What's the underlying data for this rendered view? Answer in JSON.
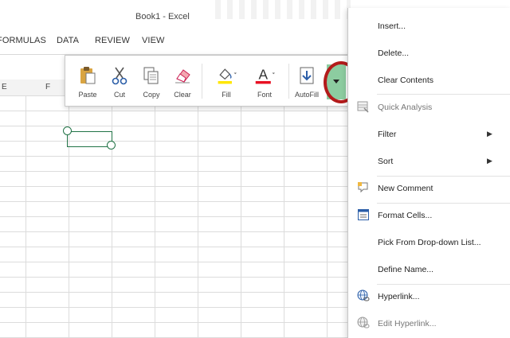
{
  "window": {
    "title": "Book1 - Excel"
  },
  "ribbon_tabs": [
    "FORMULAS",
    "DATA",
    "REVIEW",
    "VIEW"
  ],
  "column_headers": [
    "E",
    "F"
  ],
  "mini_toolbar": {
    "paste": "Paste",
    "cut": "Cut",
    "copy": "Copy",
    "clear": "Clear",
    "fill": "Fill",
    "font": "Font",
    "autofill": "AutoFill"
  },
  "context_menu": {
    "insert": "Insert...",
    "delete": "Delete...",
    "clear_contents": "Clear Contents",
    "quick_analysis": "Quick Analysis",
    "filter": "Filter",
    "sort": "Sort",
    "new_comment": "New Comment",
    "format_cells": "Format Cells...",
    "pick_from_list": "Pick From Drop-down List...",
    "define_name": "Define Name...",
    "hyperlink": "Hyperlink...",
    "edit_hyperlink": "Edit Hyperlink..."
  },
  "colors": {
    "excel_green": "#217346",
    "highlight_green": "#8ccca0",
    "annotation_red": "#b31b1b",
    "fill_yellow": "#ffe600",
    "font_red": "#e81123"
  }
}
